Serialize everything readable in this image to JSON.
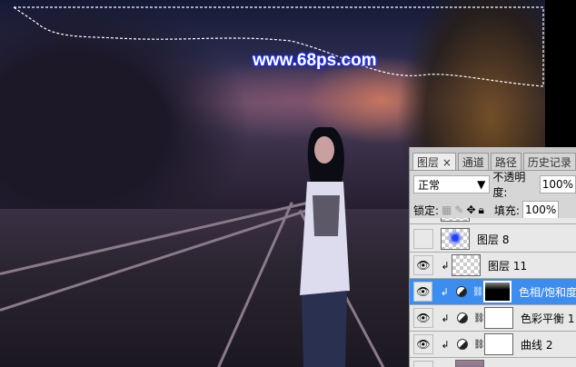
{
  "canvas": {
    "watermark": "www.68ps.com"
  },
  "panel": {
    "tabs": [
      {
        "label": "图层 ×"
      },
      {
        "label": "通道"
      },
      {
        "label": "路径"
      },
      {
        "label": "历史记录"
      }
    ],
    "blend_mode": "正常",
    "opacity_label": "不透明度:",
    "opacity_value": "100%",
    "lock_label": "锁定:",
    "fill_label": "填充:",
    "fill_value": "100%",
    "layers": [
      {
        "name": "图层 8",
        "visible": false
      },
      {
        "name": "图层 11",
        "visible": true
      },
      {
        "name": "色相/饱和度",
        "visible": true,
        "selected": true
      },
      {
        "name": "色彩平衡 1",
        "visible": true
      },
      {
        "name": "曲线 2",
        "visible": true
      }
    ]
  }
}
